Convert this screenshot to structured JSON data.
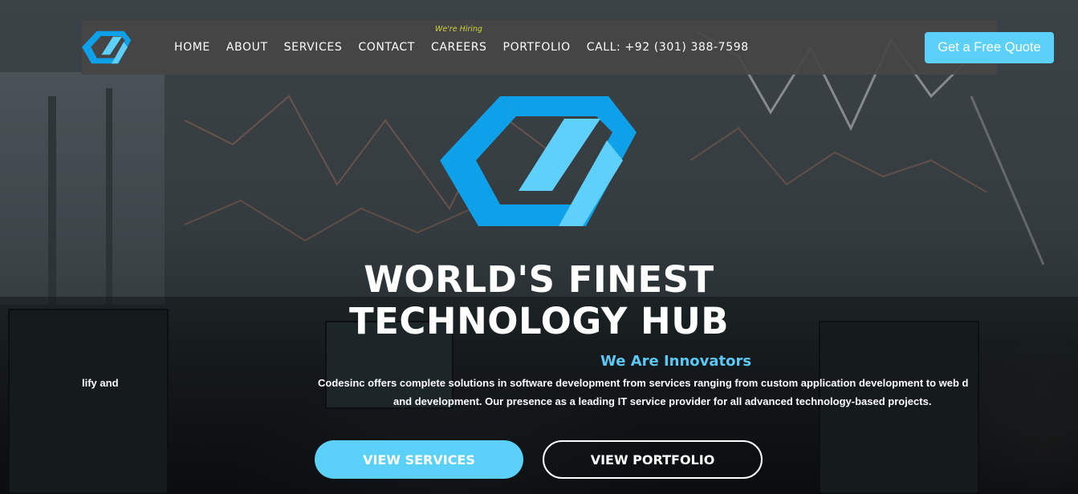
{
  "navbar": {
    "logo_icon": "codesinc-logo-icon",
    "links": [
      {
        "label": "HOME"
      },
      {
        "label": "ABOUT"
      },
      {
        "label": "SERVICES"
      },
      {
        "label": "CONTACT"
      },
      {
        "label": "CAREERS",
        "badge": "We're Hiring"
      },
      {
        "label": "PORTFOLIO"
      },
      {
        "label": "CALL: +92 (301) 388-7598"
      }
    ],
    "cta_label": "Get a Free Quote"
  },
  "hero": {
    "logo_icon": "codesinc-logo-icon",
    "title_line1": "WORLD'S FINEST",
    "title_line2": "TECHNOLOGY HUB",
    "tagline": "We Are Innovators",
    "left_fragment": "lify and",
    "description_line1": "Codesinc offers complete solutions in software development from services ranging from custom application development to web d",
    "description_line2": "and development. Our presence as a leading IT service provider for all advanced technology-based projects.",
    "primary_button": "VIEW SERVICES",
    "secondary_button": "VIEW PORTFOLIO"
  },
  "colors": {
    "accent": "#5bd1fa",
    "logo_dark": "#0ea0e8",
    "logo_light": "#5fd0fb",
    "hiring_badge": "#d4d43a",
    "navbar_bg": "#464646"
  }
}
